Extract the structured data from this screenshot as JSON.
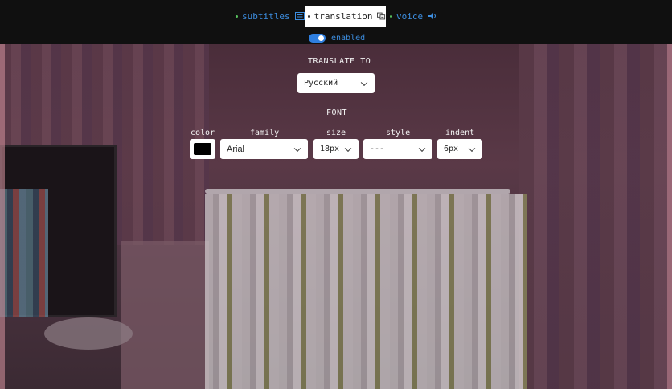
{
  "tabs": {
    "subtitles": {
      "label": "subtitles",
      "icon": "subtitles-icon"
    },
    "translation": {
      "label": "translation",
      "icon": "translate-icon",
      "active": true
    },
    "voice": {
      "label": "voice",
      "icon": "speaker-icon"
    }
  },
  "toggle": {
    "label": "enabled",
    "on": true
  },
  "translate_to": {
    "label": "TRANSLATE TO",
    "selected": "Русский"
  },
  "font": {
    "label": "FONT",
    "columns": {
      "color": "color",
      "family": "family",
      "size": "size",
      "style": "style",
      "indent": "indent"
    },
    "color_value": "#000000",
    "family_value": "Arial",
    "size_value": "18px",
    "style_value": "---",
    "indent_value": "6px"
  },
  "colors": {
    "accent": "#3d8ee0",
    "toggle_on": "#2f7fe0",
    "dot": "#58c25e",
    "bar_bg": "#101010"
  }
}
